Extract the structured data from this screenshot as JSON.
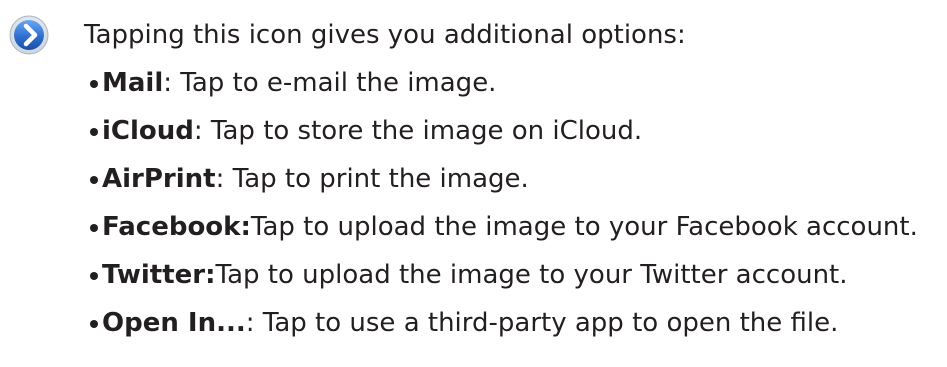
{
  "header": {
    "icon": "chevron-right-circle-icon",
    "icon_color": "#2f6fd0",
    "text": "Tapping this icon gives you additional options:"
  },
  "options": [
    {
      "name": "Mail",
      "desc": ": Tap to e-mail the image."
    },
    {
      "name": "iCloud",
      "desc": ": Tap to store the image on iCloud."
    },
    {
      "name": "AirPrint",
      "desc": ": Tap to print the image."
    },
    {
      "name": "Facebook:",
      "desc": " Tap to upload the image to your Facebook account."
    },
    {
      "name": "Twitter:",
      "desc": " Tap to upload the image to your Twitter account."
    },
    {
      "name": "Open In...",
      "desc": ": Tap to use a third-party app to open the file."
    }
  ]
}
